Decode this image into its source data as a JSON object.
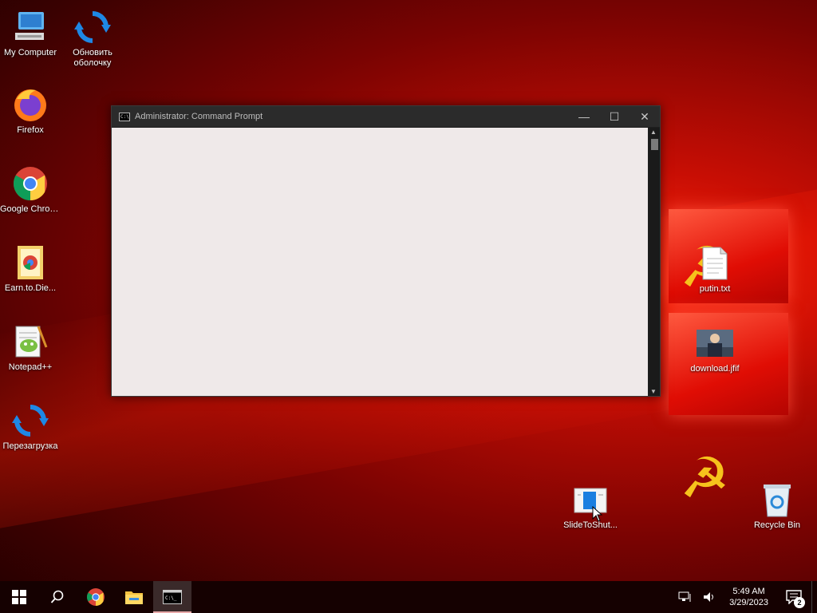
{
  "desktop": {
    "icons": [
      {
        "label": "My Computer"
      },
      {
        "label": "Обновить оболочку"
      },
      {
        "label": "Firefox"
      },
      {
        "label": "Google Chrome"
      },
      {
        "label": "Earn.to.Die..."
      },
      {
        "label": "Notepad++"
      },
      {
        "label": "Перезагрузка"
      },
      {
        "label": "putin.txt"
      },
      {
        "label": "download.jfif"
      },
      {
        "label": "SlideToShut..."
      },
      {
        "label": "Recycle Bin"
      }
    ]
  },
  "window": {
    "title": "Administrator:  Command Prompt",
    "minimize": "—",
    "maximize": "☐",
    "close": "✕"
  },
  "taskbar": {
    "start": "start-icon",
    "search": "search-icon",
    "pinned": [
      "chrome-icon",
      "file-explorer-icon",
      "command-prompt-icon"
    ],
    "time": "5:49 AM",
    "date": "3/29/2023",
    "notification_count": "2"
  }
}
